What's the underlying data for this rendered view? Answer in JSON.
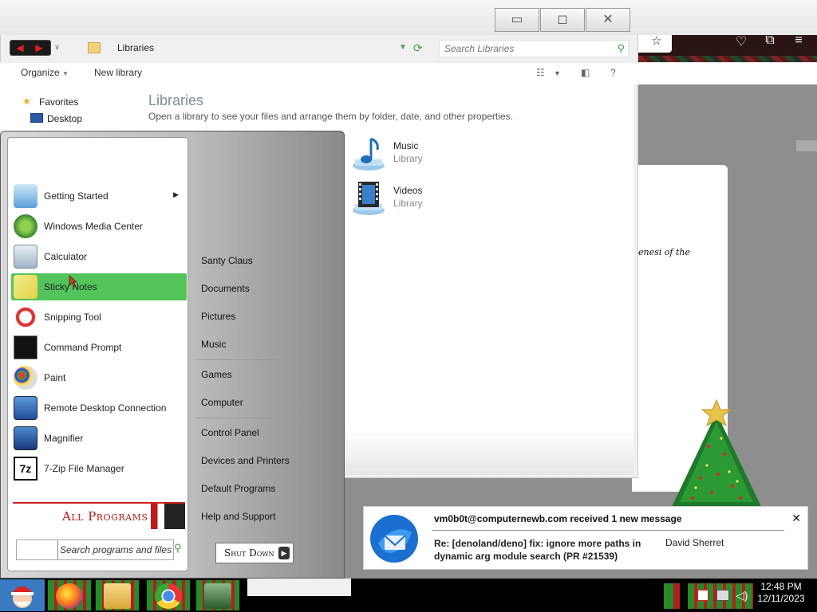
{
  "explorer": {
    "window_controls": {
      "minimize": "▭",
      "maximize": "◻",
      "close": "✕"
    },
    "breadcrumb": "Libraries",
    "search_placeholder": "Search Libraries",
    "toolbar": {
      "organize": "Organize",
      "new_library": "New library",
      "help": "?"
    },
    "nav": {
      "favorites": "Favorites",
      "desktop": "Desktop"
    },
    "heading": "Libraries",
    "description": "Open a library to see your files and arrange them by folder, date, and other properties.",
    "libraries": [
      {
        "name": "Music",
        "type": "Library",
        "icon": "music-library-icon"
      },
      {
        "name": "Videos",
        "type": "Library",
        "icon": "videos-library-icon"
      }
    ]
  },
  "start_menu": {
    "programs": [
      {
        "label": "Getting Started",
        "icon": "getting-started-icon",
        "submenu": true
      },
      {
        "label": "Windows Media Center",
        "icon": "media-center-icon"
      },
      {
        "label": "Calculator",
        "icon": "calculator-icon"
      },
      {
        "label": "Sticky Notes",
        "icon": "sticky-notes-icon",
        "selected": true
      },
      {
        "label": "Snipping Tool",
        "icon": "snipping-tool-icon"
      },
      {
        "label": "Command Prompt",
        "icon": "command-prompt-icon"
      },
      {
        "label": "Paint",
        "icon": "paint-icon"
      },
      {
        "label": "Remote Desktop Connection",
        "icon": "remote-desktop-icon"
      },
      {
        "label": "Magnifier",
        "icon": "magnifier-icon"
      },
      {
        "label": "7-Zip File Manager",
        "icon": "7zip-icon"
      }
    ],
    "all_programs": "All Programs",
    "search_placeholder": "Search programs and files",
    "places": {
      "user": "Santy Claus",
      "documents": "Documents",
      "pictures": "Pictures",
      "music": "Music",
      "games": "Games",
      "computer": "Computer",
      "control_panel": "Control Panel",
      "devices": "Devices and Printers",
      "default_programs": "Default Programs",
      "help": "Help and Support"
    },
    "shutdown": "Shut Down"
  },
  "notification": {
    "title": "vm0b0t@computernewb.com received 1 new message",
    "subject": "Re: [denoland/deno] fix: ignore more paths in dynamic arg module search (PR #21539)",
    "sender": "David Sherret",
    "close": "✕"
  },
  "taskbar": {
    "apps": [
      "firefox-icon",
      "file-explorer-icon",
      "chrome-icon",
      "computer-app-icon"
    ],
    "time": "12:48 PM",
    "date": "12/11/2023"
  },
  "browser": {
    "new_tab": "+",
    "tab_list": "⌄",
    "min": "—",
    "restore": "❐",
    "close": "✕"
  },
  "background_doc_text": "enesi of the",
  "colors": {
    "selection": "#53c45a",
    "all_programs_red": "#b01818",
    "taskbar": "#000000"
  }
}
